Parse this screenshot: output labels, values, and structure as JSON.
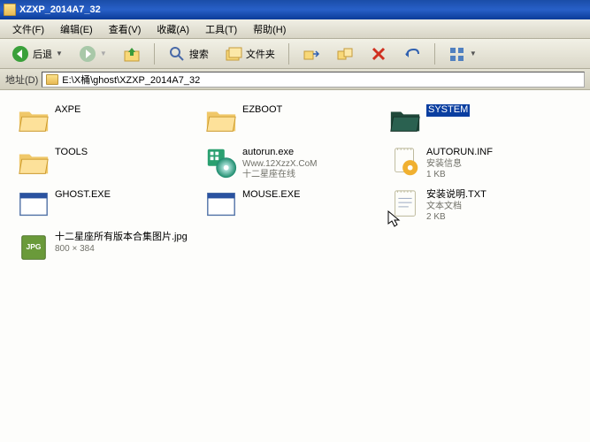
{
  "title": "XZXP_2014A7_32",
  "menu": {
    "file": "文件(F)",
    "edit": "编辑(E)",
    "view": "查看(V)",
    "fav": "收藏(A)",
    "tools": "工具(T)",
    "help": "帮助(H)"
  },
  "toolbar": {
    "back": "后退",
    "search": "搜索",
    "folders": "文件夹"
  },
  "address": {
    "label": "地址(D)",
    "path": "E:\\X桶\\ghost\\XZXP_2014A7_32"
  },
  "items": {
    "axpe": {
      "name": "AXPE"
    },
    "tools": {
      "name": "TOOLS"
    },
    "ghost": {
      "name": "GHOST.EXE"
    },
    "jpgfile": {
      "name": "十二星座所有版本合集图片.jpg",
      "sub": "800 × 384"
    },
    "ezboot": {
      "name": "EZBOOT"
    },
    "autorun": {
      "name": "autorun.exe",
      "sub1": "Www.12XzzX.CoM",
      "sub2": "十二星座在线"
    },
    "mouse": {
      "name": "MOUSE.EXE"
    },
    "system": {
      "name": "SYSTEM"
    },
    "autoruninf": {
      "name": "AUTORUN.INF",
      "sub1": "安装信息",
      "sub2": "1 KB"
    },
    "install": {
      "name": "安装说明.TXT",
      "sub1": "文本文档",
      "sub2": "2 KB"
    }
  }
}
